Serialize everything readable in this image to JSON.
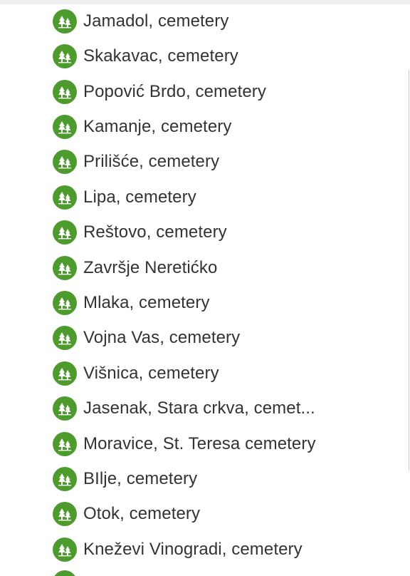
{
  "colors": {
    "pin_green": "#4c9b2c",
    "text": "#333333"
  },
  "pin_icon": "cemetery-trees-icon",
  "cemeteries": [
    "Jamadol, cemetery",
    "Skakavac, cemetery",
    "Popović Brdo, cemetery",
    "Kamanje, cemetery",
    "Prilišće, cemetery",
    "Lipa, cemetery",
    "Reštovo, cemetery",
    "Završje Neretićko",
    "Mlaka, cemetery",
    "Vojna Vas, cemetery",
    "Višnica, cemetery",
    "Jasenak, Stara crkva, cemet...",
    "Moravice, St. Teresa cemetery",
    "BIlje, cemetery",
    "Otok, cemetery",
    "Kneževi Vinogradi, cemetery"
  ]
}
